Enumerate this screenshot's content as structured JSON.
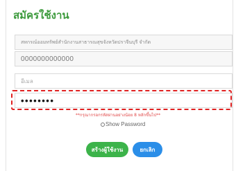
{
  "form": {
    "title": "สมัครใช้งาน",
    "agency_value": "สหกรณ์ออมทรัพย์สำนักงานสาธารณสุขจังหวัดปราจีนบุรี จำกัด",
    "phone_value": "0000000000000",
    "email_placeholder": "อีเมล",
    "password_value": "••••••••",
    "password_hint": "**กรุณากรอกรหัสผ่านอย่างน้อย 8 หลักขึ้นไป**",
    "show_password_label": "Show Password",
    "create_button_label": "สร้างผู้ใช้งาน",
    "cancel_button_label": "ยกเลิก"
  },
  "colors": {
    "title": "#3c9a3c",
    "highlight": "#e02020",
    "hint": "#e04848",
    "create_button": "#3cb34a",
    "cancel_button": "#2b8ee8"
  }
}
